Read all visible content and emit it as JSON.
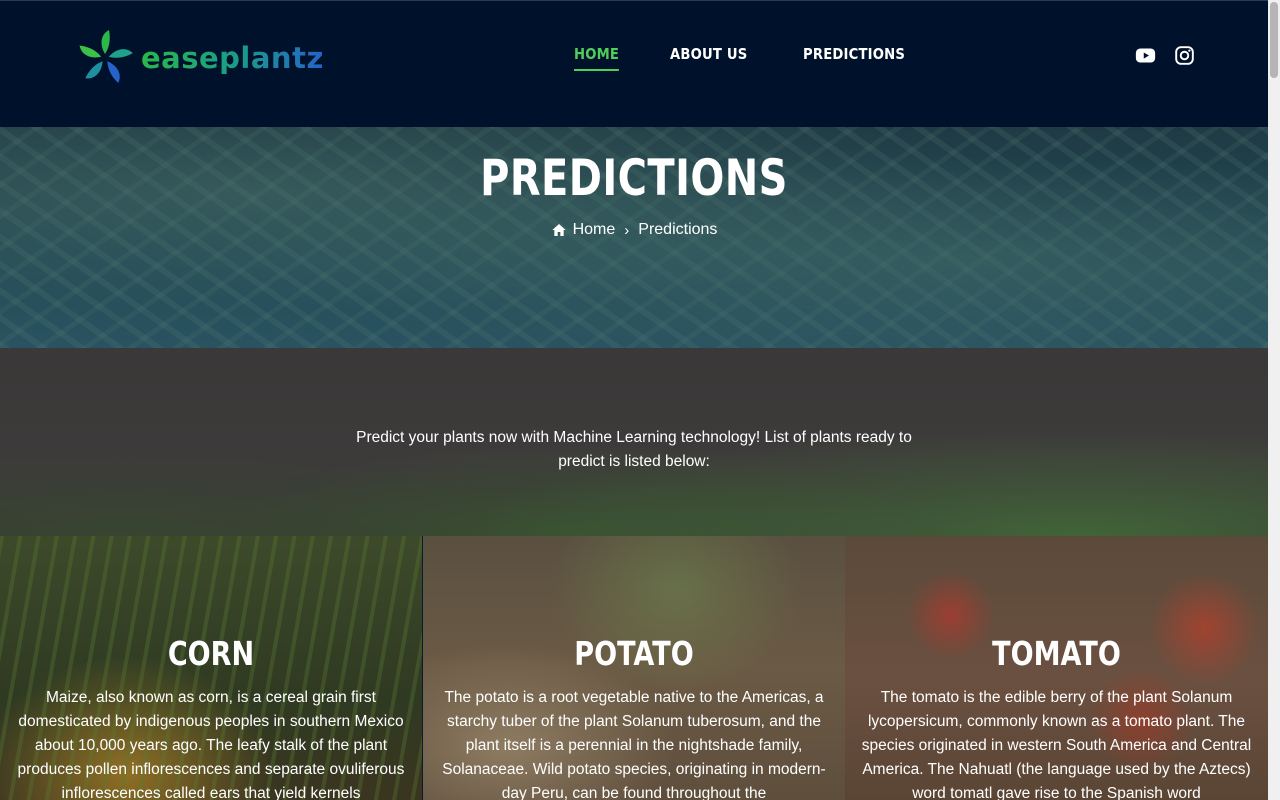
{
  "brand": {
    "name": "easeplantz"
  },
  "nav": {
    "items": [
      {
        "label": "HOME",
        "active": true
      },
      {
        "label": "ABOUT US",
        "active": false
      },
      {
        "label": "PREDICTIONS",
        "active": false
      }
    ]
  },
  "social": {
    "icons": [
      "youtube-icon",
      "instagram-icon"
    ]
  },
  "hero": {
    "title": "PREDICTIONS",
    "breadcrumb": {
      "home": "Home",
      "current": "Predictions"
    }
  },
  "intro": {
    "text": "Predict your plants now with Machine Learning technology! List of plants ready to predict is listed below:"
  },
  "cards": [
    {
      "title": "CORN",
      "text": "Maize, also known as corn, is a cereal grain first domesticated by indigenous peoples in southern Mexico about 10,000 years ago. The leafy stalk of the plant produces pollen inflorescences and separate ovuliferous inflorescences called ears that yield kernels"
    },
    {
      "title": "POTATO",
      "text": "The potato is a root vegetable native to the Americas, a starchy tuber of the plant Solanum tuberosum, and the plant itself is a perennial in the nightshade family, Solanaceae. Wild potato species, originating in modern-day Peru, can be found throughout the"
    },
    {
      "title": "TOMATO",
      "text": "The tomato is the edible berry of the plant Solanum lycopersicum, commonly known as a tomato plant. The species originated in western South America and Central America. The Nahuatl (the language used by the Aztecs) word tomatl gave rise to the Spanish word"
    }
  ],
  "colors": {
    "header_bg": "#00112b",
    "accent": "#4fcf5a"
  }
}
